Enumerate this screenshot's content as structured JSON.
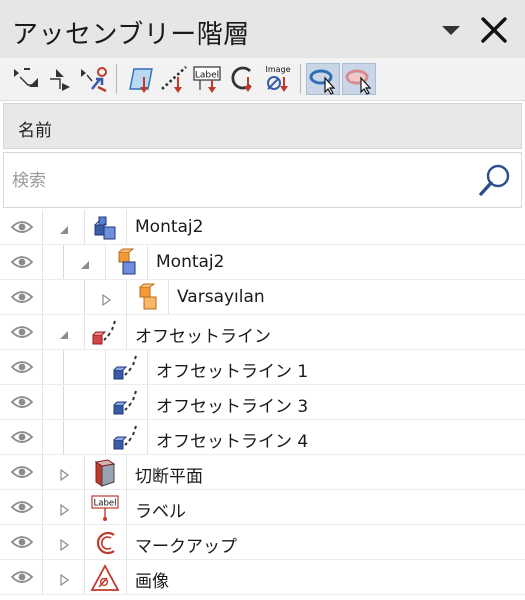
{
  "panel": {
    "title": "アッセンブリー階層",
    "menu_icon": "triangle-down-icon",
    "close_icon": "close-icon"
  },
  "toolbar": {
    "groups": [
      [
        "expand-all-icon",
        "collapse-all-icon",
        "tree-settings-icon"
      ],
      [
        "plane-icon",
        "offset-line-icon",
        "label-icon",
        "markup-icon",
        "image-icon"
      ],
      [
        "select-icon",
        "deselect-icon"
      ]
    ],
    "label_icon_text": "Label",
    "image_icon_text": "Image"
  },
  "column_header": {
    "name": "名前"
  },
  "search": {
    "placeholder": "検索",
    "value": "",
    "icon": "search-icon"
  },
  "tree": {
    "rows": [
      {
        "label": "Montaj2",
        "depth": 0,
        "expander": "expanded",
        "icon": "assembly-icon"
      },
      {
        "label": "Montaj2",
        "depth": 1,
        "expander": "expanded",
        "icon": "subassembly-icon"
      },
      {
        "label": "Varsayılan",
        "depth": 2,
        "expander": "collapsed",
        "icon": "config-icon"
      },
      {
        "label": "オフセットライン",
        "depth": 0,
        "expander": "expanded",
        "icon": "offset-line-icon"
      },
      {
        "label": "オフセットライン 1",
        "depth": 1,
        "expander": "none",
        "icon": "offset-line-icon"
      },
      {
        "label": "オフセットライン 3",
        "depth": 1,
        "expander": "none",
        "icon": "offset-line-icon"
      },
      {
        "label": "オフセットライン 4",
        "depth": 1,
        "expander": "none",
        "icon": "offset-line-icon"
      },
      {
        "label": "切断平面",
        "depth": 0,
        "expander": "collapsed",
        "icon": "cutting-plane-icon"
      },
      {
        "label": "ラベル",
        "depth": 0,
        "expander": "collapsed",
        "icon": "label-icon"
      },
      {
        "label": "マークアップ",
        "depth": 0,
        "expander": "collapsed",
        "icon": "markup-icon"
      },
      {
        "label": "画像",
        "depth": 0,
        "expander": "collapsed",
        "icon": "image-icon"
      }
    ],
    "label_icon_text": "Label"
  },
  "colors": {
    "title_bar": "#e6e6e6",
    "toolbar": "#f2f2f2",
    "accent_red": "#c0392b",
    "accent_blue": "#3a5ba8",
    "accent_orange": "#f29a3a"
  }
}
